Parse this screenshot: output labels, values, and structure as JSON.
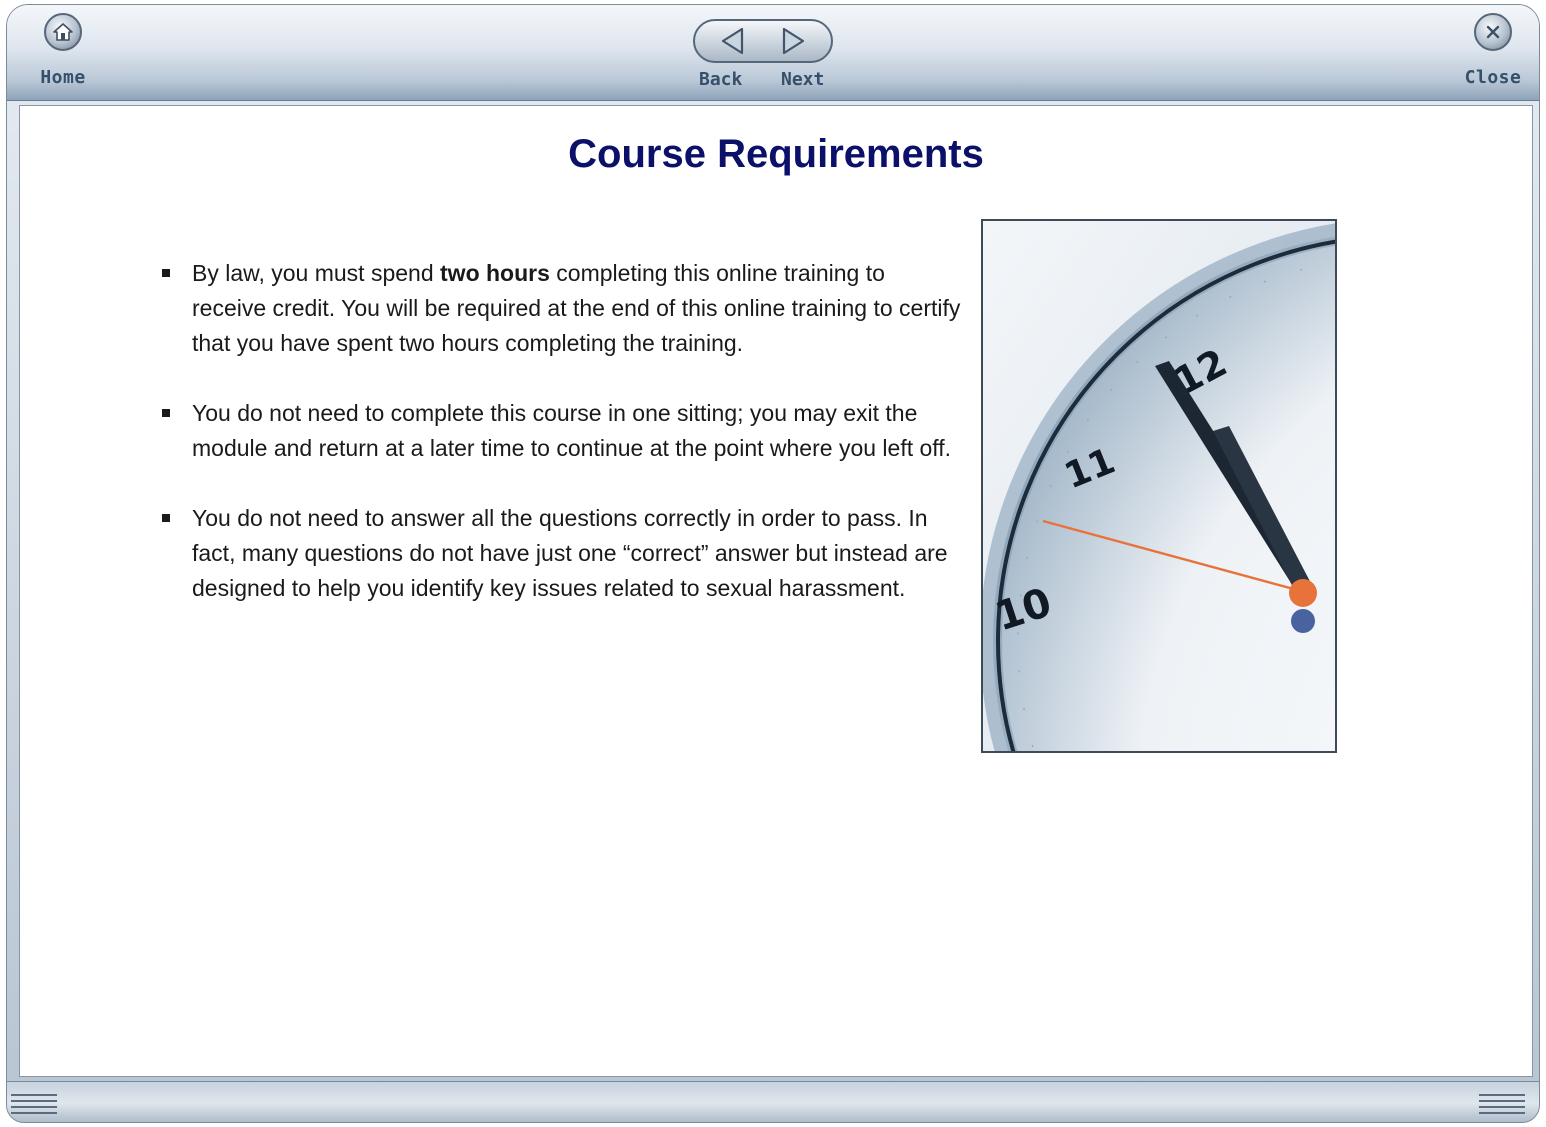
{
  "toolbar": {
    "home_label": "Home",
    "back_label": "Back",
    "next_label": "Next",
    "close_label": "Close"
  },
  "page": {
    "title": "Course Requirements",
    "bullets": [
      {
        "before": "By law, you must spend ",
        "bold": "two hours",
        "after": " completing this online training to receive credit. You will be required at the end of this online training to certify that you have spent two hours completing the training."
      },
      {
        "text": "You do not need to complete this course in one sitting; you may exit the module and return at a later time to continue at the point where you left off."
      },
      {
        "text": "You do not need to answer all the questions correctly in order to pass. In fact, many questions do not have just one “correct” answer but instead are designed to help you identify key issues related to sexual harassment."
      }
    ]
  },
  "image": {
    "numerals": [
      "12",
      "11",
      "10"
    ]
  },
  "colors": {
    "title": "#0b1068",
    "chrome": "#b9c7d6",
    "second_hand": "#e8733a"
  }
}
